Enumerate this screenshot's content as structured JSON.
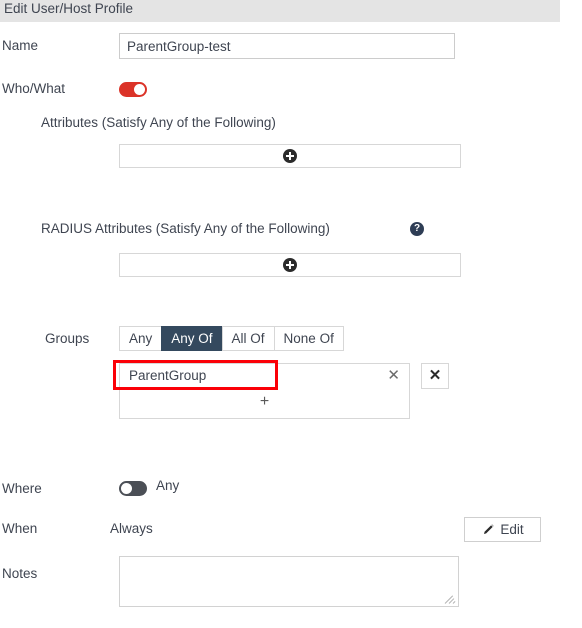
{
  "header": {
    "title": "Edit User/Host Profile"
  },
  "fields": {
    "name": {
      "label": "Name",
      "value": "ParentGroup-test",
      "placeholder": ""
    },
    "who_what": {
      "label": "Who/What",
      "toggle_state": "on",
      "toggle_color": "#db3328"
    },
    "attributes": {
      "label": "Attributes (Satisfy Any of the Following)",
      "add_icon": "plus-circle-icon"
    },
    "radius_attributes": {
      "label": "RADIUS Attributes (Satisfy Any of the Following)",
      "help_icon": "question-mark-icon",
      "add_icon": "plus-circle-icon"
    },
    "groups": {
      "label": "Groups",
      "options": [
        "Any",
        "Any Of",
        "All Of",
        "None Of"
      ],
      "selected": "Any Of",
      "selected_color": "#34495e",
      "items": [
        {
          "name": "ParentGroup",
          "remove_icon": "x-icon"
        }
      ],
      "add_row_icon": "plus-icon",
      "clear_icon": "x-icon",
      "annotation_color": "#fb0007"
    },
    "where": {
      "label": "Where",
      "toggle_state": "off",
      "toggle_color": "#4b4f56",
      "value": "Any"
    },
    "when": {
      "label": "When",
      "value": "Always",
      "edit_label": "Edit",
      "edit_icon": "pencil-icon"
    },
    "notes": {
      "label": "Notes",
      "value": "",
      "placeholder": ""
    }
  }
}
